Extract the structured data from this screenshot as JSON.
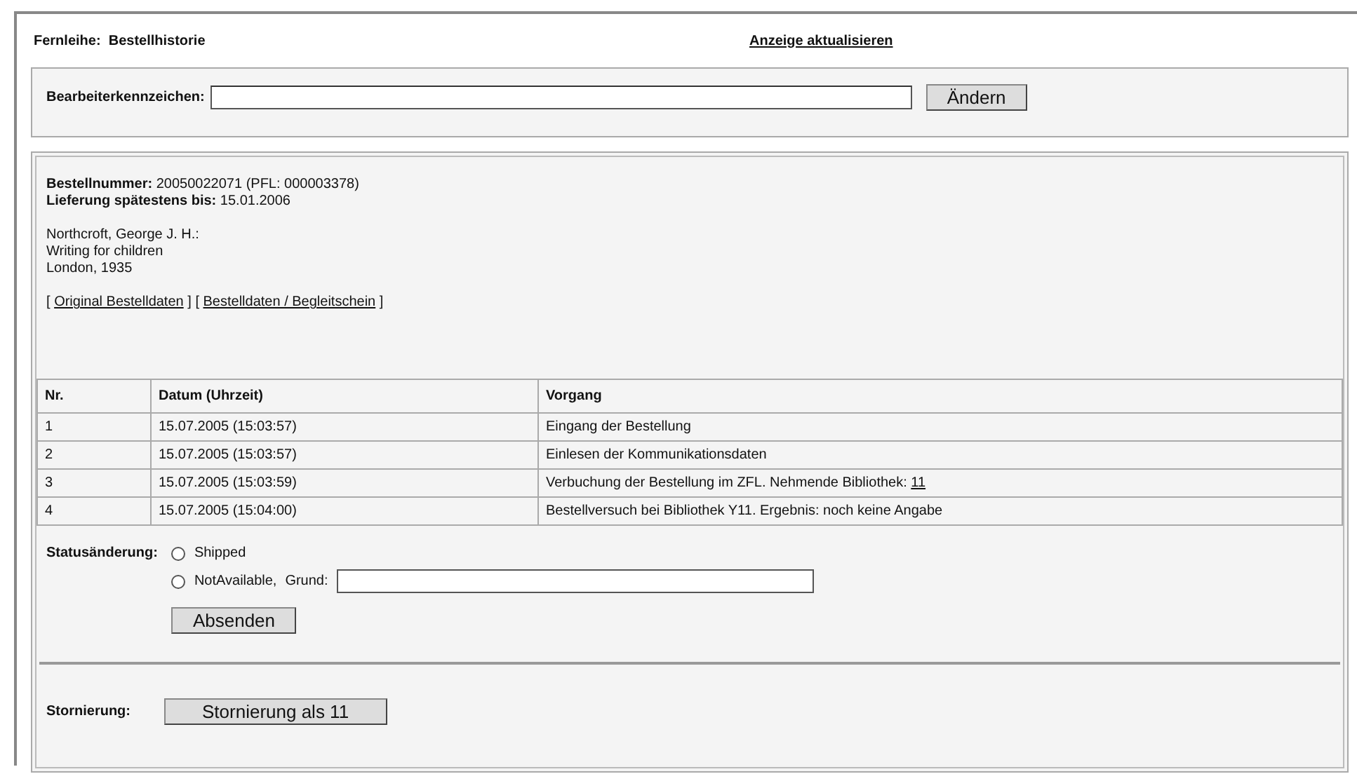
{
  "header": {
    "title": "Fernleihe:  Bestellhistorie",
    "refresh_link": "Anzeige aktualisieren"
  },
  "editor": {
    "label": "Bearbeiterkennzeichen:",
    "button": "Ändern"
  },
  "order": {
    "number_label": "Bestellnummer:",
    "number": "20050022071 (PFL: 000003378)",
    "deadline_label": "Lieferung spätestens bis:",
    "deadline": "15.01.2006",
    "citation": [
      "Northcroft, George J. H.:",
      "Writing for children",
      "London, 1935"
    ],
    "links": [
      {
        "open": "[",
        "label": "Original Bestelldaten",
        "close": "]"
      },
      {
        "open": "[",
        "label": "Bestelldaten / Begleitschein",
        "close": "]"
      }
    ]
  },
  "table": {
    "columns": [
      "Nr.",
      "Datum (Uhrzeit)",
      "Vorgang"
    ],
    "rows": [
      {
        "nr": "1",
        "datum": "15.07.2005 (15:03:57)",
        "vorgang": "Eingang der Bestellung"
      },
      {
        "nr": "2",
        "datum": "15.07.2005 (15:03:57)",
        "vorgang": "Einlesen der Kommunikationsdaten"
      },
      {
        "nr": "3",
        "datum": "15.07.2005 (15:03:59)",
        "vorgang": "Verbuchung der Bestellung im ZFL. Nehmende Bibliothek:",
        "link": "11"
      },
      {
        "nr": "4",
        "datum": "15.07.2005 (15:04:00)",
        "vorgang": "Bestellversuch bei Bibliothek Y11. Ergebnis: noch keine Angabe"
      }
    ]
  },
  "status_change": {
    "label": "Statusänderung:",
    "options": [
      {
        "kind": "plain",
        "label": "Shipped",
        "selected": false
      },
      {
        "kind": "with_reason",
        "label": "NotAvailable,",
        "reason_label": "Grund:",
        "selected": false
      }
    ],
    "button": "Absenden"
  },
  "cancellation": {
    "label": "Stornierung:",
    "button": "Stornierung als 11"
  }
}
